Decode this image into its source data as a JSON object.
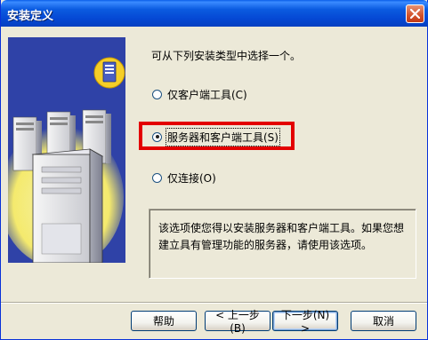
{
  "window": {
    "title": "安装定义"
  },
  "wizard": {
    "prompt": "可从下列安装类型中选择一个。",
    "options": [
      {
        "label": "仅客户端工具(C)",
        "selected": false
      },
      {
        "label": "服务器和客户端工具(S)",
        "selected": true
      },
      {
        "label": "仅连接(O)",
        "selected": false
      }
    ],
    "description": "该选项使您得以安装服务器和客户端工具。如果您想建立具有管理功能的服务器，请使用该选项。"
  },
  "buttons": {
    "help": "帮助",
    "back": "< 上一步(B)",
    "next": "下一步(N) >",
    "cancel": "取消"
  },
  "colors": {
    "highlight": "#E30000",
    "titlebar": "#0548D4"
  },
  "icons": [
    "close-icon",
    "server-icon",
    "document-server-icon"
  ]
}
